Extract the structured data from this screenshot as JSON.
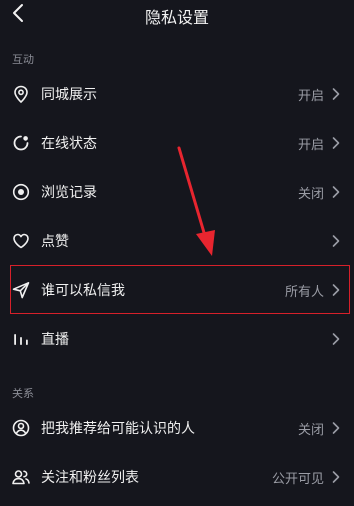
{
  "header": {
    "title": "隐私设置"
  },
  "sections": [
    {
      "label": "互动",
      "items": [
        {
          "icon": "location-pin-icon",
          "label": "同城展示",
          "value": "开启"
        },
        {
          "icon": "online-status-icon",
          "label": "在线状态",
          "value": "开启"
        },
        {
          "icon": "eye-icon",
          "label": "浏览记录",
          "value": "关闭"
        },
        {
          "icon": "heart-icon",
          "label": "点赞",
          "value": ""
        },
        {
          "icon": "paper-plane-icon",
          "label": "谁可以私信我",
          "value": "所有人"
        },
        {
          "icon": "live-bars-icon",
          "label": "直播",
          "value": ""
        }
      ]
    },
    {
      "label": "关系",
      "items": [
        {
          "icon": "user-circle-icon",
          "label": "把我推荐给可能认识的人",
          "value": "关闭"
        },
        {
          "icon": "users-icon",
          "label": "关注和粉丝列表",
          "value": "公开可见"
        }
      ]
    }
  ],
  "colors": {
    "background": "#15161d",
    "highlight": "#d6202a",
    "arrow": "#e8252f"
  }
}
